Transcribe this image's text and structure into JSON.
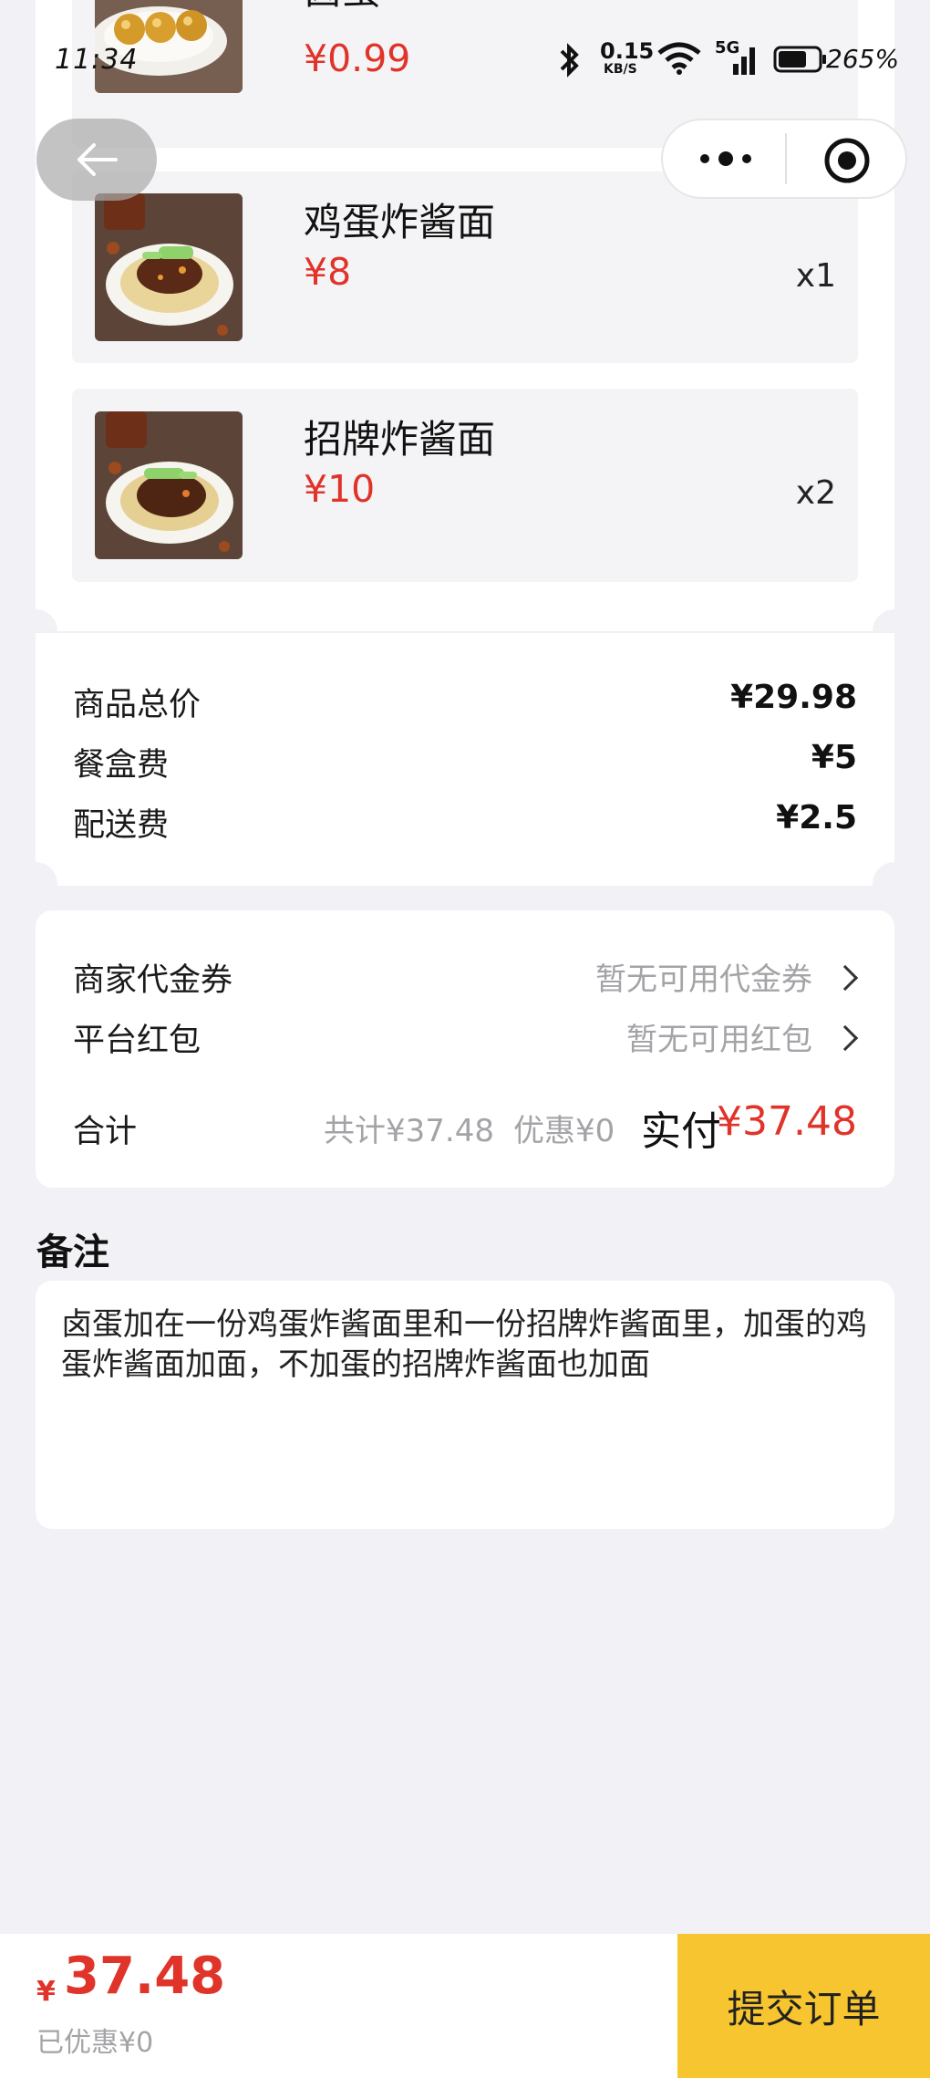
{
  "status_bar": {
    "time": "11:34",
    "net_speed": "0.15",
    "net_unit": "KB/S",
    "signal_label": "5G",
    "battery": "265%"
  },
  "items": [
    {
      "name": "卤蛋",
      "price": "¥0.99",
      "qty": ""
    },
    {
      "name": "鸡蛋炸酱面",
      "price": "¥8",
      "qty": "x1"
    },
    {
      "name": "招牌炸酱面",
      "price": "¥10",
      "qty": "x2"
    }
  ],
  "fees": {
    "goods_total_label": "商品总价",
    "goods_total_value": "¥29.98",
    "box_fee_label": "餐盒费",
    "box_fee_value": "¥5",
    "delivery_fee_label": "配送费",
    "delivery_fee_value": "¥2.5"
  },
  "discounts": {
    "voucher_label": "商家代金券",
    "voucher_value": "暂无可用代金券",
    "redpacket_label": "平台红包",
    "redpacket_value": "暂无可用红包",
    "total_label": "合计",
    "subtotal_text": "共计¥37.48",
    "discount_text": "优惠¥0",
    "pay_label": "实付",
    "pay_value": "¥37.48"
  },
  "remarks": {
    "title": "备注",
    "text": "卤蛋加在一份鸡蛋炸酱面里和一份招牌炸酱面里，加蛋的鸡蛋炸酱面加面，不加蛋的招牌炸酱面也加面"
  },
  "bottom_bar": {
    "currency": "¥",
    "amount": "37.48",
    "saved_text": "已优惠¥0",
    "submit_label": "提交订单"
  },
  "colors": {
    "accent_red": "#e0332a",
    "submit_yellow": "#f7c52f",
    "page_bg": "#f2f2f6"
  }
}
